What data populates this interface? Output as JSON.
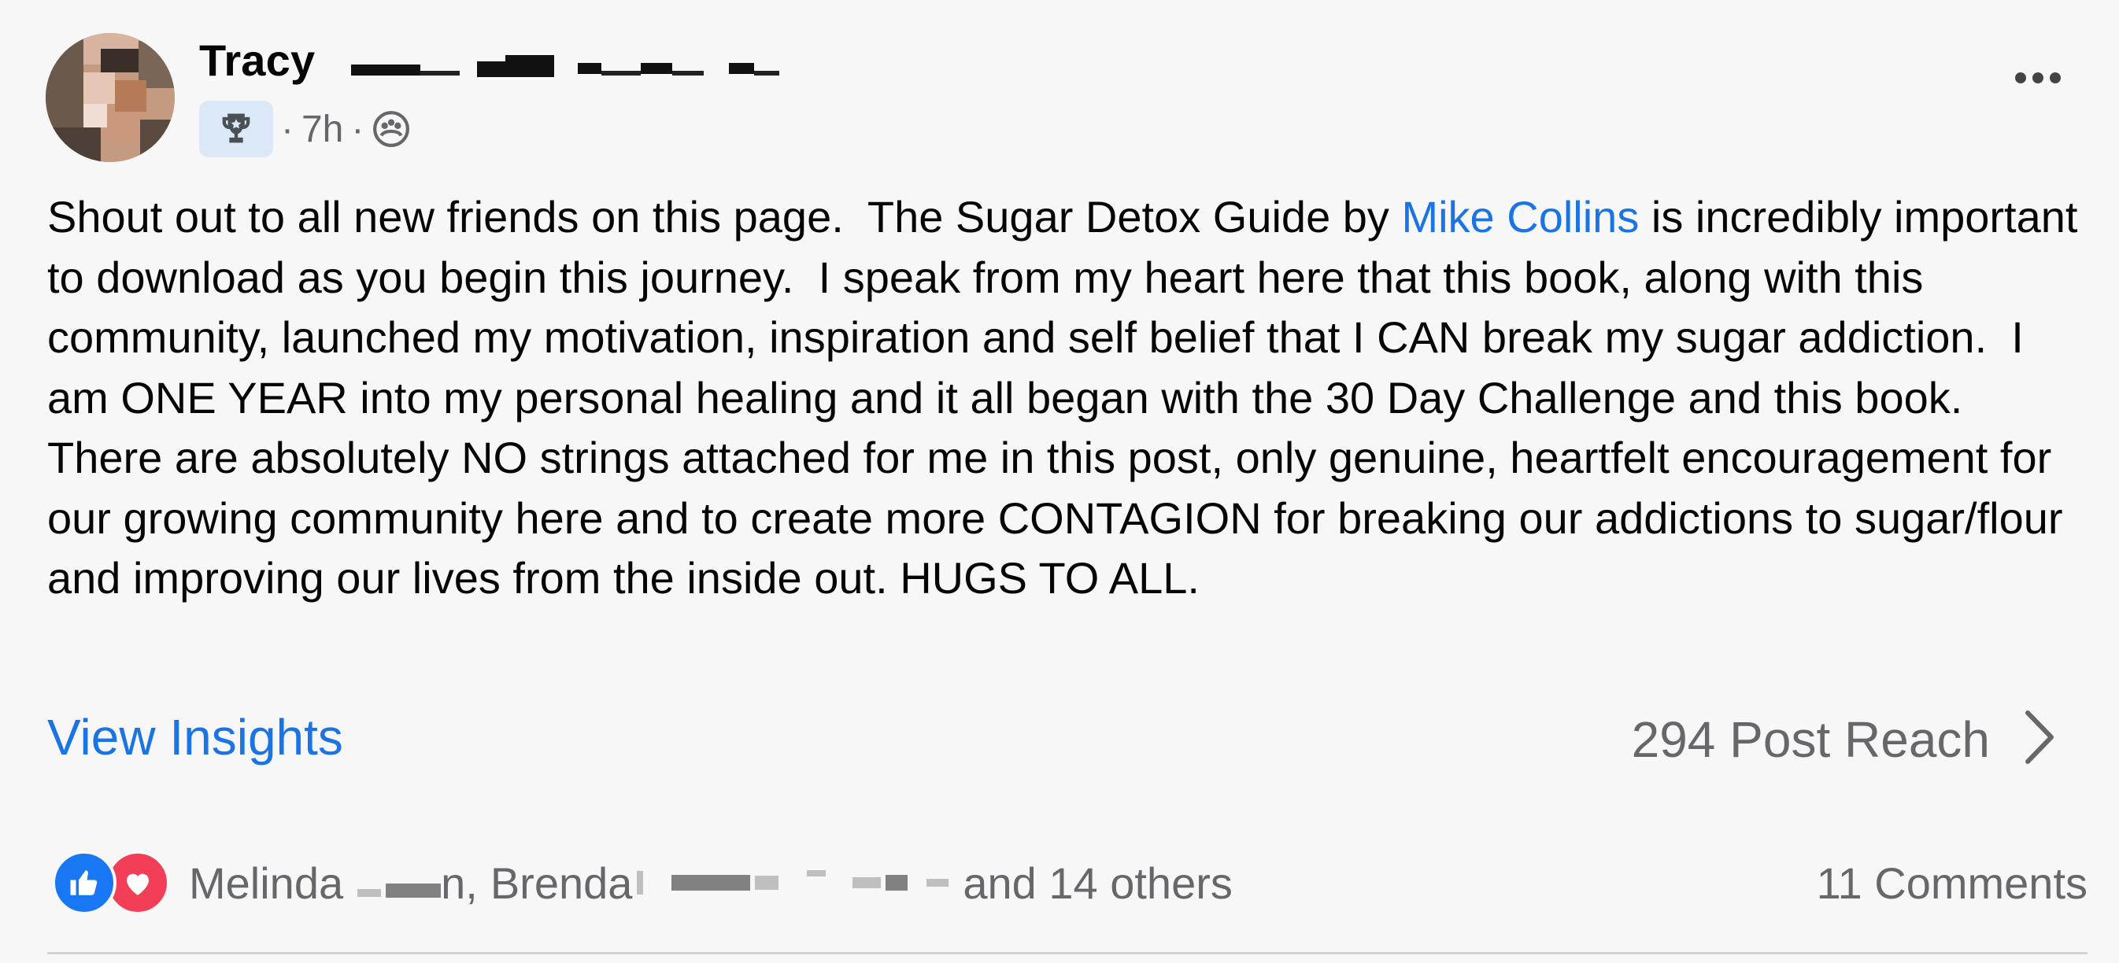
{
  "post": {
    "author": "Tracy",
    "time": "7h",
    "text_before_mention": "Shout out to all new friends on this page.  The Sugar Detox Guide by ",
    "mention": "Mike Collins",
    "text_after_mention": " is incredibly important to download as you begin this journey.  I speak from my heart here that this book, along with this community, launched my motivation, inspiration and self belief that I CAN break my sugar addiction.  I am ONE YEAR into my personal healing and it all began with the 30 Day Challenge and this book.  There are absolutely NO strings attached for me in this post, only genuine, heartfelt encouragement for our growing community here and to create more CONTAGION for breaking our addictions to sugar/flour and improving our lives from the inside out. HUGS TO ALL."
  },
  "insights": {
    "view_label": "View Insights",
    "reach_label": "294 Post Reach"
  },
  "footer": {
    "reactor_1": "Melinda",
    "reactor_1_suffix": "n,",
    "reactor_2": "Brenda",
    "others_text": "and 14 others",
    "comments_label": "11 Comments"
  },
  "colors": {
    "link": "#1b74e4",
    "secondary_text": "#65676b",
    "like": "#1877f2",
    "love": "#f33e58",
    "badge_bg": "#dbe8f7"
  },
  "icons": {
    "badge": "trophy-icon",
    "audience": "group-icon",
    "more": "more-options-icon",
    "reach": "chevron-right-icon",
    "like": "like-reaction-icon",
    "love": "love-reaction-icon"
  }
}
